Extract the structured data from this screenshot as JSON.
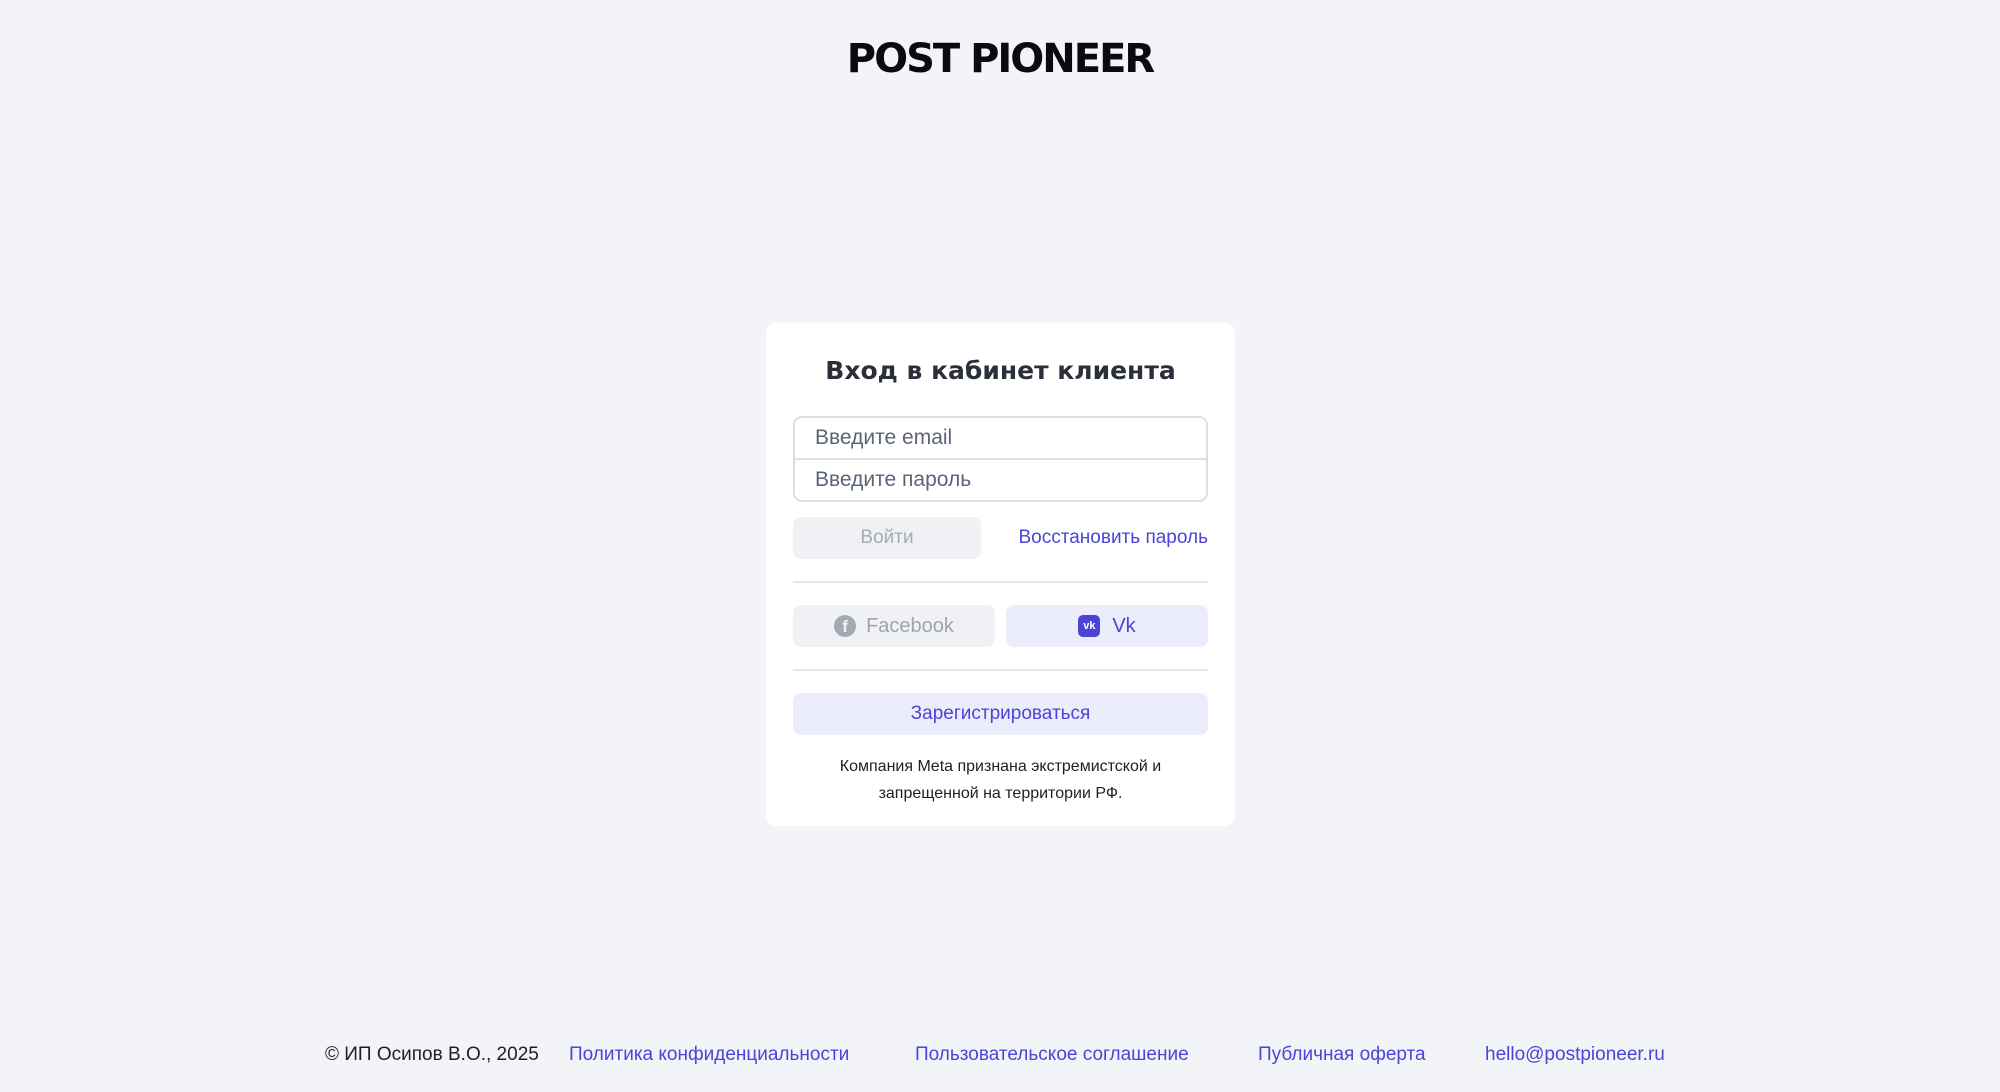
{
  "brand": {
    "logo": "POST PIONEER"
  },
  "login_card": {
    "title": "Вход в кабинет клиента",
    "email_placeholder": "Введите email",
    "password_placeholder": "Введите пароль",
    "login_button": "Войти",
    "recover_link": "Восстановить пароль",
    "social": {
      "facebook_label": "Facebook",
      "facebook_icon": "facebook-icon",
      "vk_label": "Vk",
      "vk_icon": "vk-icon"
    },
    "register_button": "Зарегистрироваться",
    "notice": "Компания Meta признана экстремистской и запрещенной на территории РФ."
  },
  "footer": {
    "copyright": "© ИП Осипов В.О., 2025",
    "privacy": "Политика конфиденциальности",
    "terms": "Пользовательское соглашение",
    "offer": "Публичная оферта",
    "email": "hello@postpioneer.ru"
  },
  "colors": {
    "background": "#f3f4f7",
    "accent": "#4b44d6",
    "accent_light": "#ebedfd",
    "disabled": "#f0f1f4"
  }
}
